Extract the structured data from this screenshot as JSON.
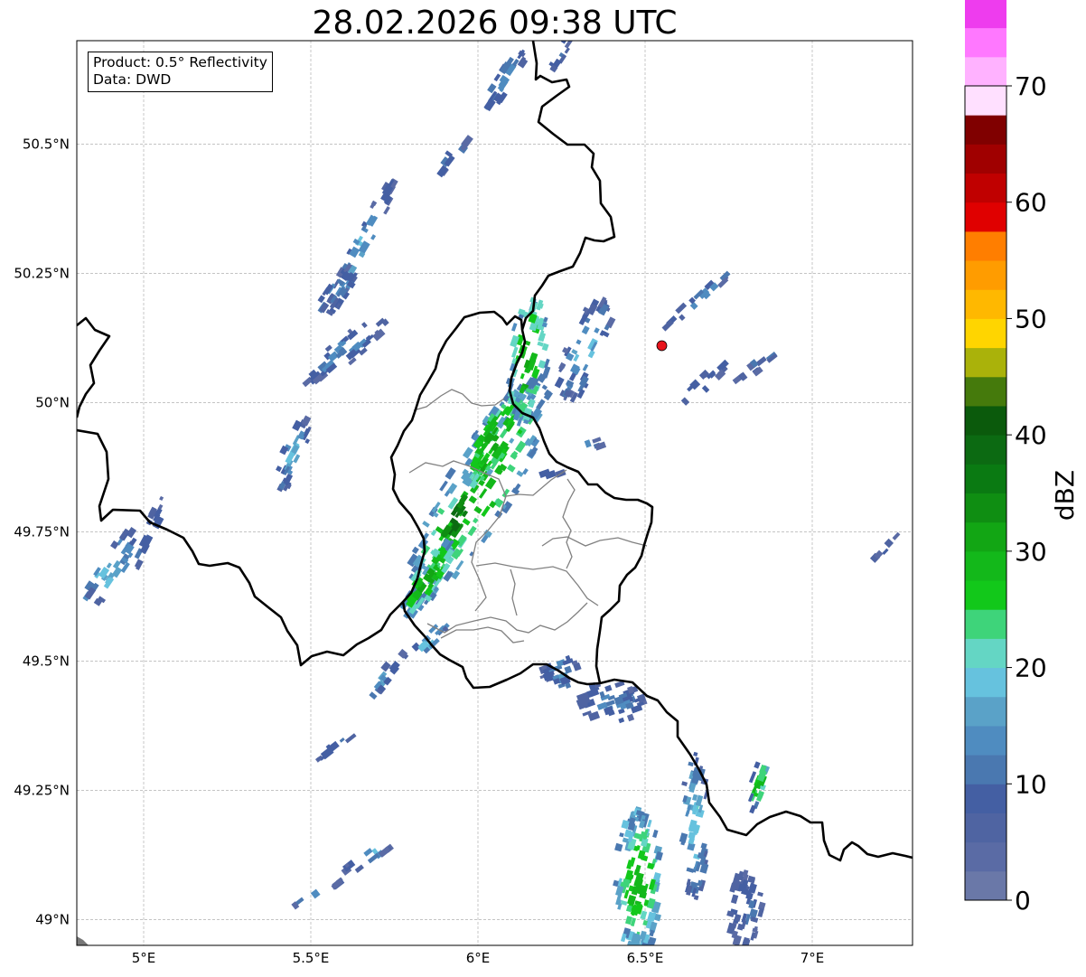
{
  "title": "28.02.2026 09:38 UTC",
  "info_box": {
    "product": "Product: 0.5° Reflectivity",
    "data": "Data: DWD"
  },
  "map": {
    "lon_range": [
      4.8,
      7.3
    ],
    "lat_range": [
      48.95,
      50.7
    ],
    "lon_ticks": [
      {
        "value": 5.0,
        "label": "5°E"
      },
      {
        "value": 5.5,
        "label": "5.5°E"
      },
      {
        "value": 6.0,
        "label": "6°E"
      },
      {
        "value": 6.5,
        "label": "6.5°E"
      },
      {
        "value": 7.0,
        "label": "7°E"
      }
    ],
    "lat_ticks": [
      {
        "value": 50.5,
        "label": "50.5°N"
      },
      {
        "value": 50.25,
        "label": "50.25°N"
      },
      {
        "value": 50.0,
        "label": "50°N"
      },
      {
        "value": 49.75,
        "label": "49.75°N"
      },
      {
        "value": 49.5,
        "label": "49.5°N"
      },
      {
        "value": 49.25,
        "label": "49.25°N"
      },
      {
        "value": 49.0,
        "label": "49°N"
      }
    ],
    "gridlines": true,
    "station_marker": {
      "lon": 6.55,
      "lat": 50.11,
      "color": "#e8141c"
    },
    "colors": {
      "national_border": "#000000",
      "district_border": "#808080",
      "grid": "#b0b0b0"
    }
  },
  "colorbar": {
    "label": "dBZ",
    "min": 0,
    "max": 70,
    "step": 2.5,
    "tick_labels": [
      {
        "value": 0,
        "label": "0"
      },
      {
        "value": 10,
        "label": "10"
      },
      {
        "value": 20,
        "label": "20"
      },
      {
        "value": 30,
        "label": "30"
      },
      {
        "value": 40,
        "label": "40"
      },
      {
        "value": 50,
        "label": "50"
      },
      {
        "value": 60,
        "label": "60"
      },
      {
        "value": 70,
        "label": "70"
      }
    ],
    "colors": [
      "#6a78a8",
      "#5a6ba5",
      "#4f64a2",
      "#445fa3",
      "#4a78b0",
      "#4f8cc0",
      "#5aa2c8",
      "#66c2de",
      "#64d6c4",
      "#3ed47a",
      "#12c81a",
      "#13b81a",
      "#12a614",
      "#0f8e12",
      "#0a7a12",
      "#0c6a12",
      "#0b5a0c",
      "#457a0c",
      "#aab20a",
      "#ffd500",
      "#ffb800",
      "#ff9c00",
      "#ff7e00",
      "#e00000",
      "#c00000",
      "#a00000",
      "#800000",
      "#ffe0ff",
      "#ffb2ff",
      "#ff78ff",
      "#ee3cee"
    ]
  },
  "regions": [
    {
      "c": [
        6.0,
        49.83
      ],
      "r": [
        0.1,
        0.25
      ],
      "ang": 60,
      "n": 170,
      "p": [
        10,
        14,
        22,
        26,
        28
      ]
    },
    {
      "c": [
        6.05,
        49.93
      ],
      "r": [
        0.05,
        0.1
      ],
      "ang": 60,
      "n": 80,
      "p": [
        14,
        22,
        26,
        28,
        30
      ]
    },
    {
      "c": [
        5.85,
        49.66
      ],
      "r": [
        0.04,
        0.08
      ],
      "ang": 60,
      "n": 60,
      "p": [
        12,
        20,
        25,
        28,
        30
      ]
    },
    {
      "c": [
        5.94,
        49.78
      ],
      "r": [
        0.03,
        0.05
      ],
      "ang": 60,
      "n": 22,
      "p": [
        28,
        32,
        36,
        38
      ]
    },
    {
      "c": [
        5.86,
        49.54
      ],
      "r": [
        0.025,
        0.05
      ],
      "ang": 40,
      "n": 14,
      "p": [
        6,
        12,
        18
      ]
    },
    {
      "c": [
        6.15,
        50.08
      ],
      "r": [
        0.06,
        0.12
      ],
      "ang": 85,
      "n": 70,
      "p": [
        12,
        20,
        24,
        28
      ]
    },
    {
      "c": [
        6.32,
        50.1
      ],
      "r": [
        0.06,
        0.1
      ],
      "ang": 70,
      "n": 55,
      "p": [
        4,
        8,
        12,
        16
      ]
    },
    {
      "c": [
        6.48,
        49.07
      ],
      "r": [
        0.07,
        0.14
      ],
      "ang": 90,
      "n": 130,
      "p": [
        10,
        16,
        22,
        25,
        27
      ]
    },
    {
      "c": [
        6.65,
        49.18
      ],
      "r": [
        0.04,
        0.14
      ],
      "ang": 90,
      "n": 60,
      "p": [
        6,
        10,
        14,
        18
      ]
    },
    {
      "c": [
        6.8,
        49.02
      ],
      "r": [
        0.05,
        0.07
      ],
      "ang": 90,
      "n": 50,
      "p": [
        4,
        6,
        9
      ]
    },
    {
      "c": [
        6.84,
        49.26
      ],
      "r": [
        0.025,
        0.05
      ],
      "ang": 80,
      "n": 20,
      "p": [
        8,
        14,
        22,
        26
      ]
    },
    {
      "c": [
        6.4,
        49.42
      ],
      "r": [
        0.06,
        0.06
      ],
      "ang": 0,
      "n": 45,
      "p": [
        4,
        8,
        12
      ]
    },
    {
      "c": [
        6.25,
        49.48
      ],
      "r": [
        0.05,
        0.03
      ],
      "ang": 0,
      "n": 28,
      "p": [
        4,
        8,
        12,
        15
      ]
    },
    {
      "c": [
        5.6,
        50.1
      ],
      "r": [
        0.04,
        0.1
      ],
      "ang": 35,
      "n": 40,
      "p": [
        4,
        8,
        12
      ]
    },
    {
      "c": [
        5.65,
        50.3
      ],
      "r": [
        0.03,
        0.14
      ],
      "ang": 65,
      "n": 45,
      "p": [
        4,
        8,
        12,
        16
      ]
    },
    {
      "c": [
        5.45,
        49.9
      ],
      "r": [
        0.04,
        0.07
      ],
      "ang": 70,
      "n": 30,
      "p": [
        4,
        8,
        12,
        16
      ]
    },
    {
      "c": [
        5.58,
        50.22
      ],
      "r": [
        0.04,
        0.05
      ],
      "ang": 60,
      "n": 20,
      "p": [
        4,
        8,
        12
      ]
    },
    {
      "c": [
        4.9,
        49.68
      ],
      "r": [
        0.04,
        0.08
      ],
      "ang": 60,
      "n": 30,
      "p": [
        6,
        12,
        16
      ]
    },
    {
      "c": [
        5.72,
        49.47
      ],
      "r": [
        0.02,
        0.06
      ],
      "ang": 50,
      "n": 14,
      "p": [
        4,
        8,
        14
      ]
    },
    {
      "c": [
        5.67,
        49.12
      ],
      "r": [
        0.02,
        0.05
      ],
      "ang": 30,
      "n": 12,
      "p": [
        4,
        8,
        12,
        16
      ]
    },
    {
      "c": [
        5.57,
        49.33
      ],
      "r": [
        0.02,
        0.04
      ],
      "ang": 30,
      "n": 8,
      "p": [
        4,
        8
      ]
    },
    {
      "c": [
        5.52,
        49.05
      ],
      "r": [
        0.015,
        0.05
      ],
      "ang": 30,
      "n": 7,
      "p": [
        4,
        8,
        12
      ]
    },
    {
      "c": [
        6.08,
        50.62
      ],
      "r": [
        0.03,
        0.07
      ],
      "ang": 60,
      "n": 24,
      "p": [
        4,
        8,
        12
      ]
    },
    {
      "c": [
        6.24,
        50.67
      ],
      "r": [
        0.02,
        0.04
      ],
      "ang": 60,
      "n": 8,
      "p": [
        4,
        8
      ]
    },
    {
      "c": [
        5.93,
        50.48
      ],
      "r": [
        0.015,
        0.05
      ],
      "ang": 55,
      "n": 8,
      "p": [
        4,
        8
      ]
    },
    {
      "c": [
        6.66,
        50.2
      ],
      "r": [
        0.015,
        0.08
      ],
      "ang": 40,
      "n": 14,
      "p": [
        4,
        8,
        12
      ]
    },
    {
      "c": [
        6.68,
        50.04
      ],
      "r": [
        0.02,
        0.06
      ],
      "ang": 40,
      "n": 12,
      "p": [
        4,
        8
      ]
    },
    {
      "c": [
        6.84,
        50.07
      ],
      "r": [
        0.015,
        0.05
      ],
      "ang": 30,
      "n": 10,
      "p": [
        4,
        8
      ]
    },
    {
      "c": [
        7.22,
        49.72
      ],
      "r": [
        0.015,
        0.03
      ],
      "ang": 45,
      "n": 5,
      "p": [
        4,
        6
      ]
    },
    {
      "c": [
        5.02,
        49.75
      ],
      "r": [
        0.02,
        0.07
      ],
      "ang": 70,
      "n": 14,
      "p": [
        4,
        8
      ]
    },
    {
      "c": [
        6.22,
        49.86
      ],
      "r": [
        0.01,
        0.02
      ],
      "ang": 0,
      "n": 3,
      "p": [
        4,
        8
      ]
    },
    {
      "c": [
        6.34,
        49.92
      ],
      "r": [
        0.015,
        0.02
      ],
      "ang": 0,
      "n": 4,
      "p": [
        4,
        8,
        12
      ]
    }
  ]
}
